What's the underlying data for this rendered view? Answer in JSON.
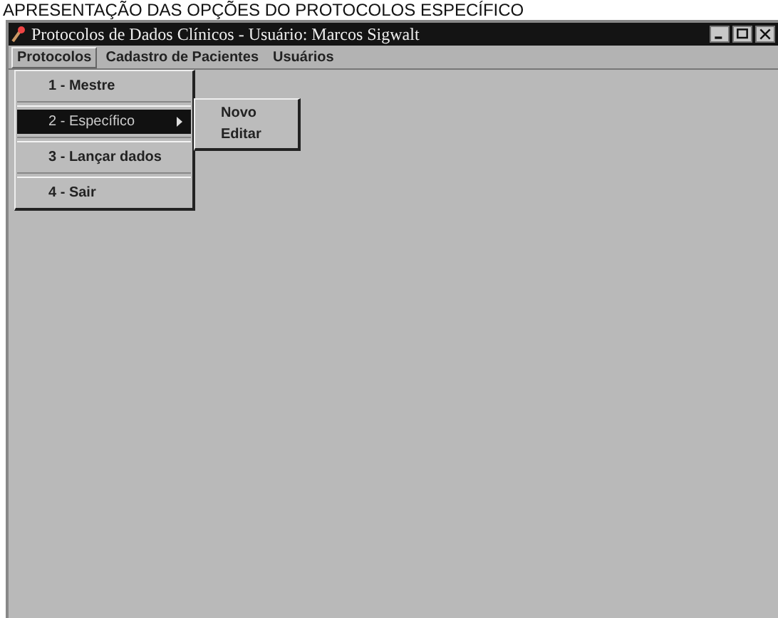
{
  "caption": "APRESENTAÇÃO DAS OPÇÕES DO PROTOCOLOS ESPECÍFICO",
  "window": {
    "title": "Protocolos de Dados Clínicos - Usuário: Marcos Sigwalt"
  },
  "menu_bar": [
    {
      "label": "Protocolos",
      "selected": true
    },
    {
      "label": "Cadastro de Pacientes",
      "selected": false
    },
    {
      "label": "Usuários",
      "selected": false
    }
  ],
  "menu": [
    {
      "kind": "item",
      "label": "1 - Mestre",
      "selected": false
    },
    {
      "kind": "separator"
    },
    {
      "kind": "submenu",
      "label": "2 - Específico",
      "selected": true
    },
    {
      "kind": "separator"
    },
    {
      "kind": "item",
      "label": "3 - Lançar dados",
      "selected": false
    },
    {
      "kind": "separator"
    },
    {
      "kind": "item",
      "label": "4 - Sair",
      "selected": false
    }
  ],
  "submenu": [
    {
      "label": "Novo"
    },
    {
      "label": "Editar"
    }
  ]
}
